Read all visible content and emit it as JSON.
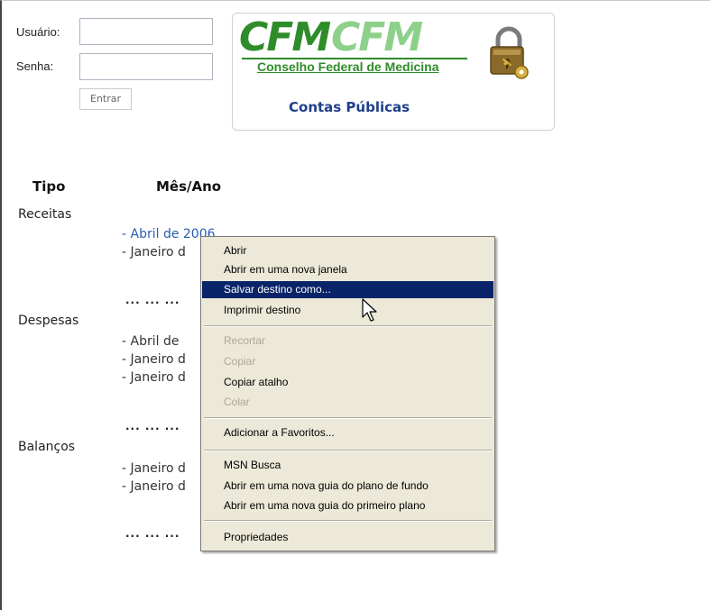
{
  "login": {
    "user_label": "Usuário:",
    "pass_label": "Senha:",
    "user_value": "",
    "pass_value": "",
    "submit_label": "Entrar"
  },
  "logo": {
    "brand_main": "CFM",
    "brand_echo": "CFM",
    "org_name": "Conselho Federal de Medicina",
    "section_title": "Contas Públicas",
    "icon": "padlock-key-icon",
    "brand_color": "#2f8c2a",
    "title_color": "#1e3f8a"
  },
  "table": {
    "col_tipo": "Tipo",
    "col_mes": "Mês/Ano",
    "sections": [
      {
        "label": "Receitas",
        "items": [
          "- Abril de 2006",
          "- Janeiro d"
        ],
        "more": "... ... ..."
      },
      {
        "label": "Despesas",
        "items": [
          "- Abril de",
          "- Janeiro d",
          "- Janeiro d"
        ],
        "more": "... ... ..."
      },
      {
        "label": "Balanços",
        "items": [
          "- Janeiro d",
          "- Janeiro d"
        ],
        "more": "... ... ..."
      }
    ],
    "link_color": "#2a5db0"
  },
  "context_menu": {
    "items": [
      {
        "label": "Abrir",
        "state": "normal"
      },
      {
        "label": "Abrir em uma nova janela",
        "state": "normal"
      },
      {
        "label": "Salvar destino como...",
        "state": "highlighted"
      },
      {
        "label": "Imprimir destino",
        "state": "normal"
      },
      {
        "label": "Recortar",
        "state": "disabled"
      },
      {
        "label": "Copiar",
        "state": "disabled"
      },
      {
        "label": "Copiar atalho",
        "state": "normal"
      },
      {
        "label": "Colar",
        "state": "disabled"
      },
      {
        "label": "Adicionar a Favoritos...",
        "state": "normal"
      },
      {
        "label": "MSN Busca",
        "state": "normal"
      },
      {
        "label": "Abrir em uma nova guia do plano de fundo",
        "state": "normal"
      },
      {
        "label": "Abrir em uma nova guia do primeiro plano",
        "state": "normal"
      },
      {
        "label": "Propriedades",
        "state": "normal"
      }
    ],
    "highlight_color": "#0a246a",
    "background_color": "#ece9d8"
  }
}
